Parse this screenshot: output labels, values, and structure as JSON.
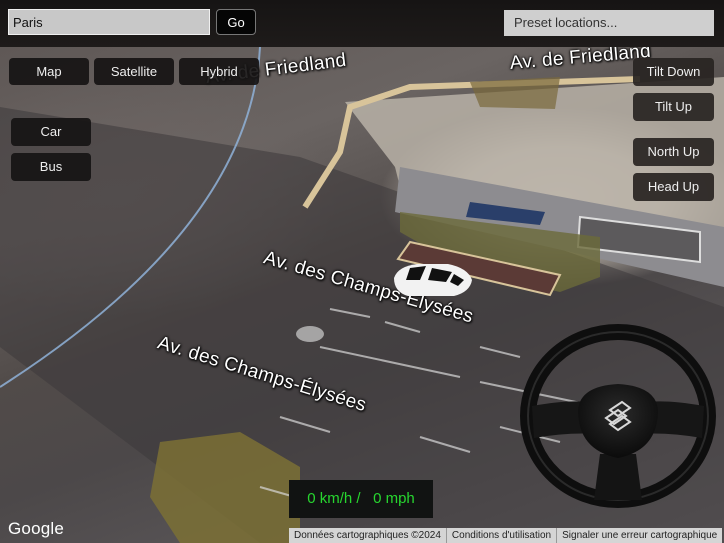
{
  "search": {
    "value": "Paris",
    "go_label": "Go"
  },
  "presets": {
    "selected": "Preset locations..."
  },
  "map_types": [
    {
      "label": "Map"
    },
    {
      "label": "Satellite"
    },
    {
      "label": "Hybrid"
    }
  ],
  "vehicles": [
    {
      "label": "Car"
    },
    {
      "label": "Bus"
    }
  ],
  "view_controls": [
    {
      "label": "Tilt Down"
    },
    {
      "label": "Tilt Up"
    },
    {
      "label": "North Up"
    },
    {
      "label": "Head Up"
    }
  ],
  "streets": [
    {
      "label": "Av. de Friedland"
    },
    {
      "label": "Av. de Friedland"
    },
    {
      "label": "Av. des Champs-Élysées"
    },
    {
      "label": "Av. des Champs-Élysées"
    }
  ],
  "speed": {
    "kmh": "0 km/h /",
    "mph": "0 mph"
  },
  "footer": {
    "map_data": "Données cartographiques ©2024",
    "terms": "Conditions d'utilisation",
    "report": "Signaler une erreur cartographique"
  },
  "logo": "Google",
  "colors": {
    "speed_text": "#27d62f",
    "button_bg": "#161414",
    "footer_bg": "#d5d5d5"
  }
}
